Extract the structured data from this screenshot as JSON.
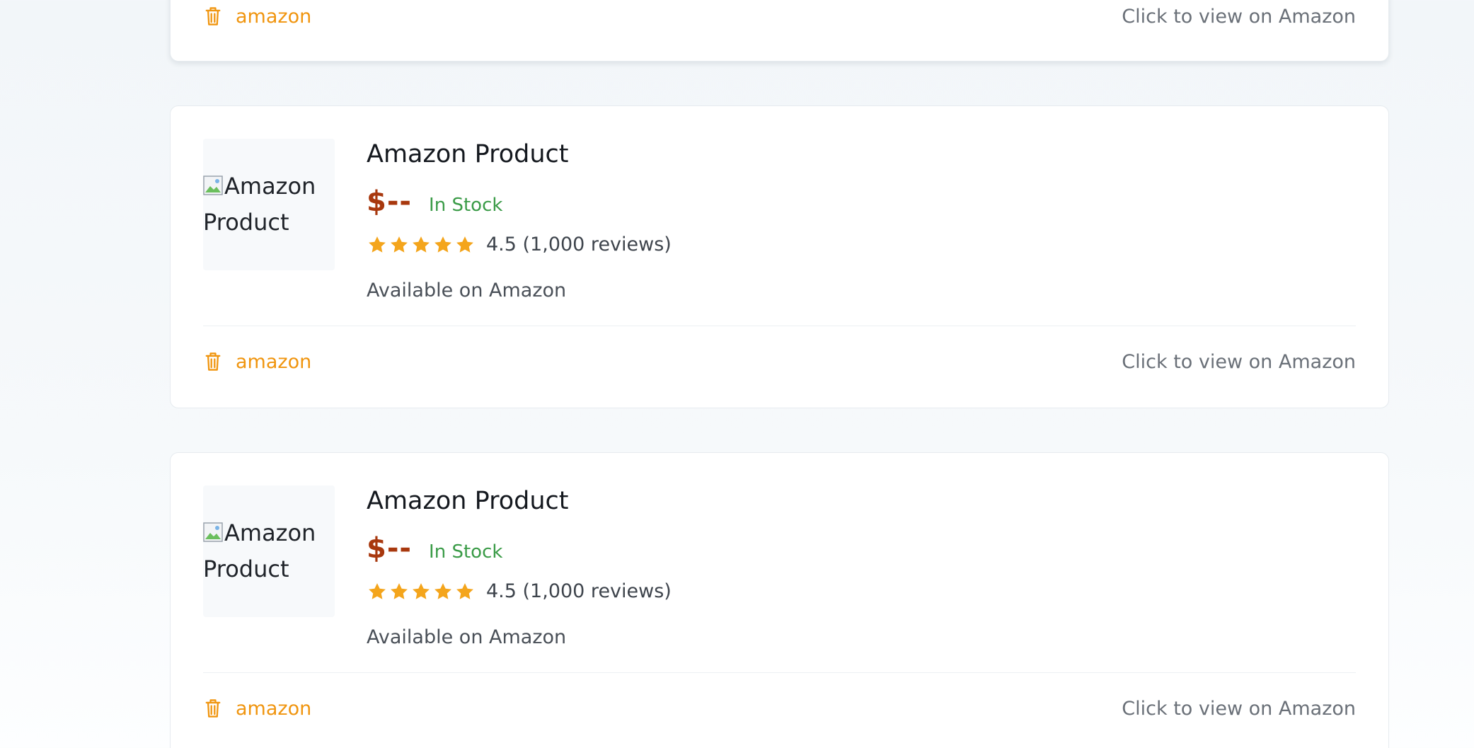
{
  "colors": {
    "price": "#a8380e",
    "in_stock": "#3a9b47",
    "star": "#f4a51c",
    "store_accent": "#f0950f",
    "link_gray": "#6a7078"
  },
  "products": [
    {
      "store": "amazon",
      "view_link": "Click to view on Amazon"
    },
    {
      "image_alt": "Amazon Product",
      "title": "Amazon Product",
      "price": "$--",
      "stock": "In Stock",
      "rating": 4.5,
      "rating_text": "4.5 (1,000 reviews)",
      "availability": "Available on Amazon",
      "store": "amazon",
      "view_link": "Click to view on Amazon"
    },
    {
      "image_alt": "Amazon Product",
      "title": "Amazon Product",
      "price": "$--",
      "stock": "In Stock",
      "rating": 4.5,
      "rating_text": "4.5 (1,000 reviews)",
      "availability": "Available on Amazon",
      "store": "amazon",
      "view_link": "Click to view on Amazon"
    }
  ],
  "icons": {
    "store": "trash-icon",
    "star": "star-icon",
    "broken_image": "broken-image-icon"
  }
}
